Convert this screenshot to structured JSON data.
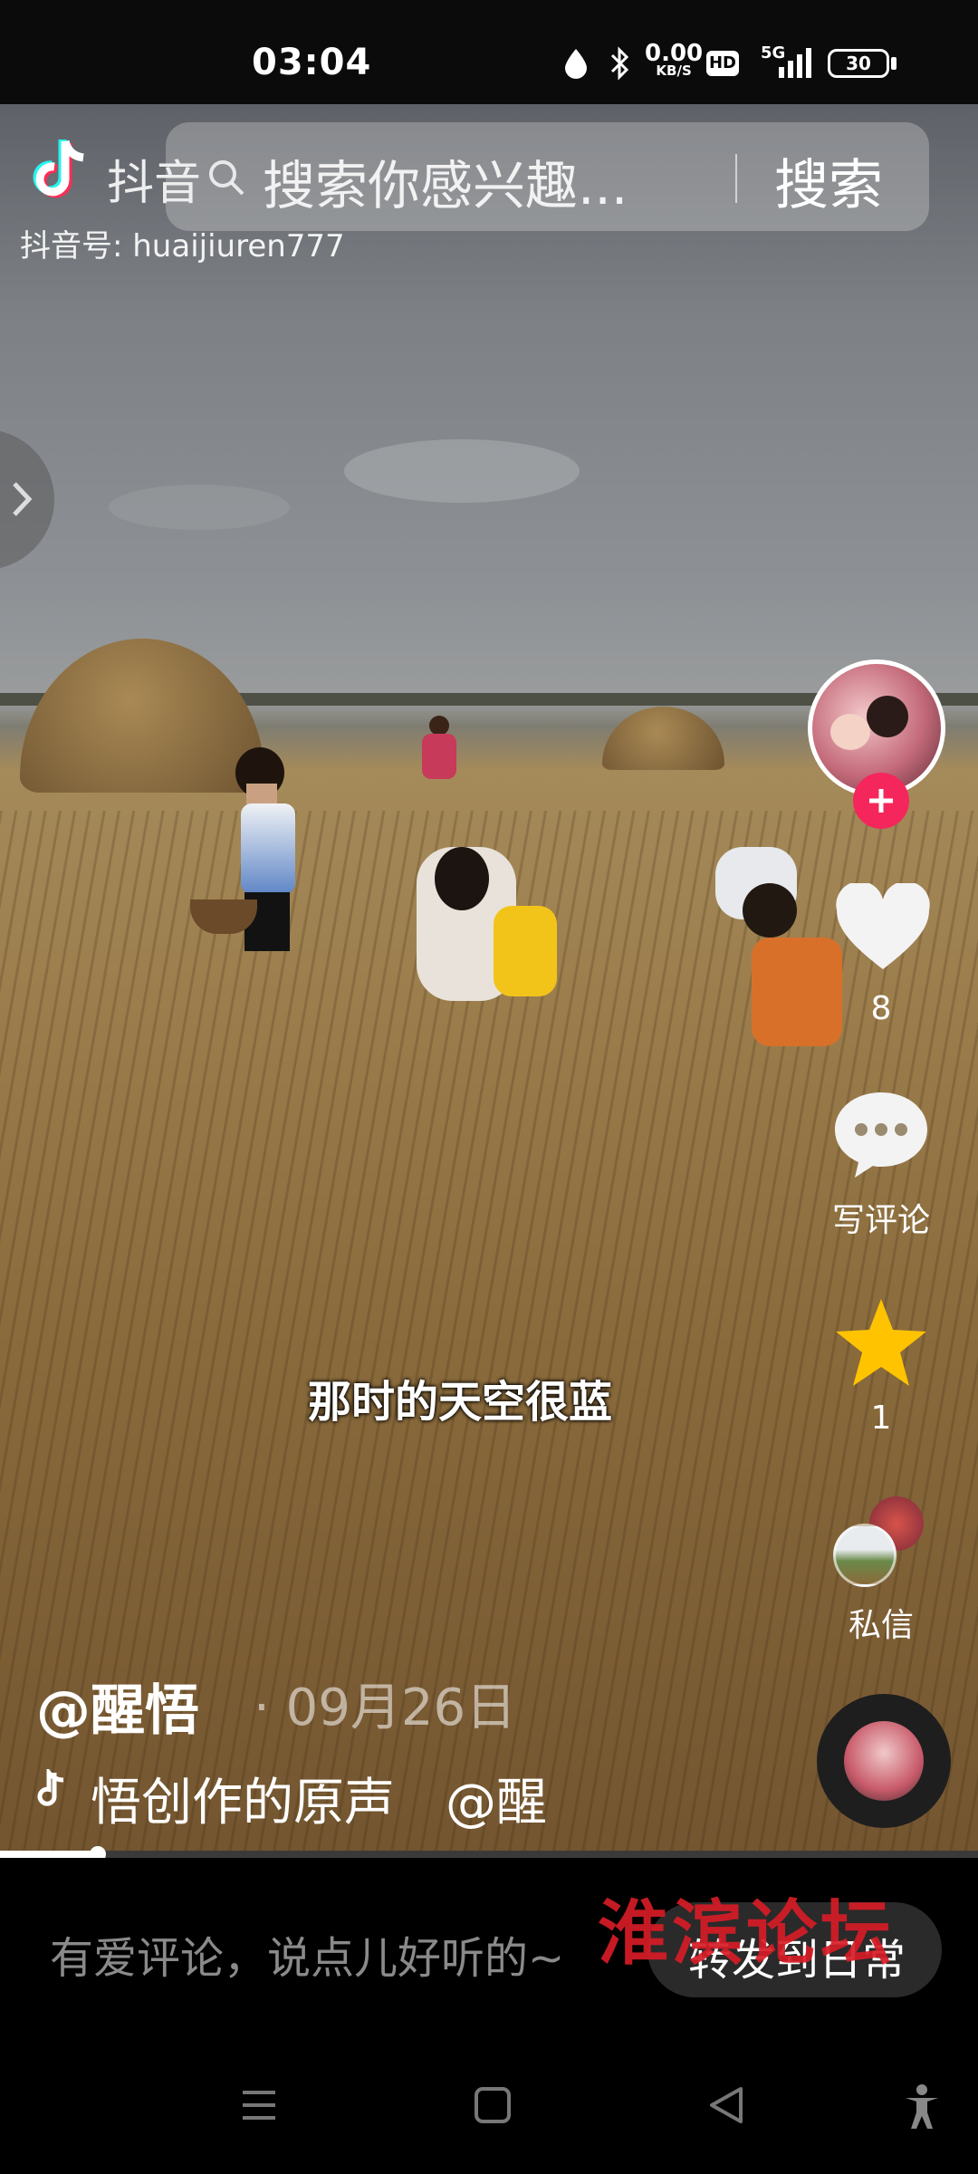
{
  "status_bar": {
    "time": "03:04",
    "network_speed": "0.00",
    "network_unit": "KB/S",
    "hd_badge": "HD",
    "signal_label": "5G",
    "battery": "30"
  },
  "top_bar": {
    "logo_label": "抖音",
    "search_placeholder": "搜索你感兴趣...",
    "search_button": "搜索",
    "douyin_id": "抖音号: huaijiuren777"
  },
  "video": {
    "caption": "那时的天空很蓝",
    "author": "@醒悟",
    "date": "· 09月26日",
    "music": "悟创作的原声　@醒",
    "progress": 0.1
  },
  "actions": {
    "likes": "8",
    "comment_label": "写评论",
    "favorites": "1",
    "message_label": "私信"
  },
  "comment_bar": {
    "placeholder": "有爱评论，说点儿好听的~",
    "share_label": "转发到日常"
  },
  "watermark": "淮滨论坛",
  "colors": {
    "follow_red": "#f5265b",
    "star_yellow": "#ffc300",
    "watermark_red": "#d61c26"
  },
  "icons": [
    "droplet-icon",
    "bluetooth-icon",
    "signal-icon",
    "battery-icon",
    "search-icon",
    "chevron-right-icon",
    "plus-icon",
    "heart-icon",
    "comment-icon",
    "star-icon",
    "music-note-icon",
    "menu-icon",
    "home-square-icon",
    "back-triangle-icon",
    "accessibility-icon"
  ]
}
